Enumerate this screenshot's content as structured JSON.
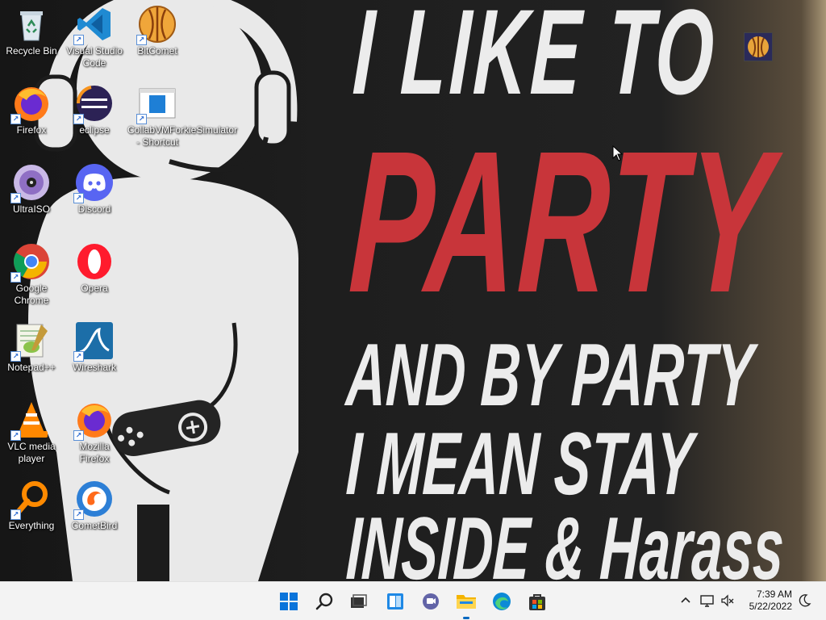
{
  "desktop": {
    "icons": [
      {
        "label": "Recycle Bin",
        "icon": "recycle-bin-icon"
      },
      {
        "label": "Visual Studio Code",
        "icon": "vscode-icon"
      },
      {
        "label": "BitComet",
        "icon": "bitcomet-icon"
      },
      {
        "label": "Firefox",
        "icon": "firefox-icon"
      },
      {
        "label": "eclipse",
        "icon": "eclipse-icon"
      },
      {
        "label": "CollabVMForkieSimulator - Shortcut",
        "icon": "collabvm-icon"
      },
      {
        "label": "UltraISO",
        "icon": "ultraiso-icon"
      },
      {
        "label": "Discord",
        "icon": "discord-icon"
      },
      {
        "label": "Google Chrome",
        "icon": "chrome-icon"
      },
      {
        "label": "Opera",
        "icon": "opera-icon"
      },
      {
        "label": "Notepad++",
        "icon": "notepadpp-icon"
      },
      {
        "label": "Wireshark",
        "icon": "wireshark-icon"
      },
      {
        "label": "VLC media player",
        "icon": "vlc-icon"
      },
      {
        "label": "Mozilla Firefox",
        "icon": "firefox-icon"
      },
      {
        "label": "Everything",
        "icon": "everything-icon"
      },
      {
        "label": "CometBird",
        "icon": "cometbird-icon"
      }
    ]
  },
  "wallpaper": {
    "line1": "I LIKE TO",
    "line2": "PARTY",
    "line3": "AND BY PARTY",
    "line4": "I MEAN STAY",
    "line5": "INSIDE & Harass",
    "accent_color": "#c8353a"
  },
  "taskbar": {
    "buttons": [
      "start-icon",
      "search-icon",
      "task-view-icon",
      "widgets-icon",
      "chat-icon",
      "file-explorer-icon",
      "edge-icon",
      "store-icon"
    ],
    "tray": {
      "time": "7:39 AM",
      "date": "5/22/2022",
      "icons": [
        "chevron-up-icon",
        "network-icon",
        "volume-muted-icon",
        "moon-icon"
      ]
    }
  },
  "colors": {
    "taskbar_bg": "#f3f3f3",
    "start_blue": "#0067c0"
  }
}
